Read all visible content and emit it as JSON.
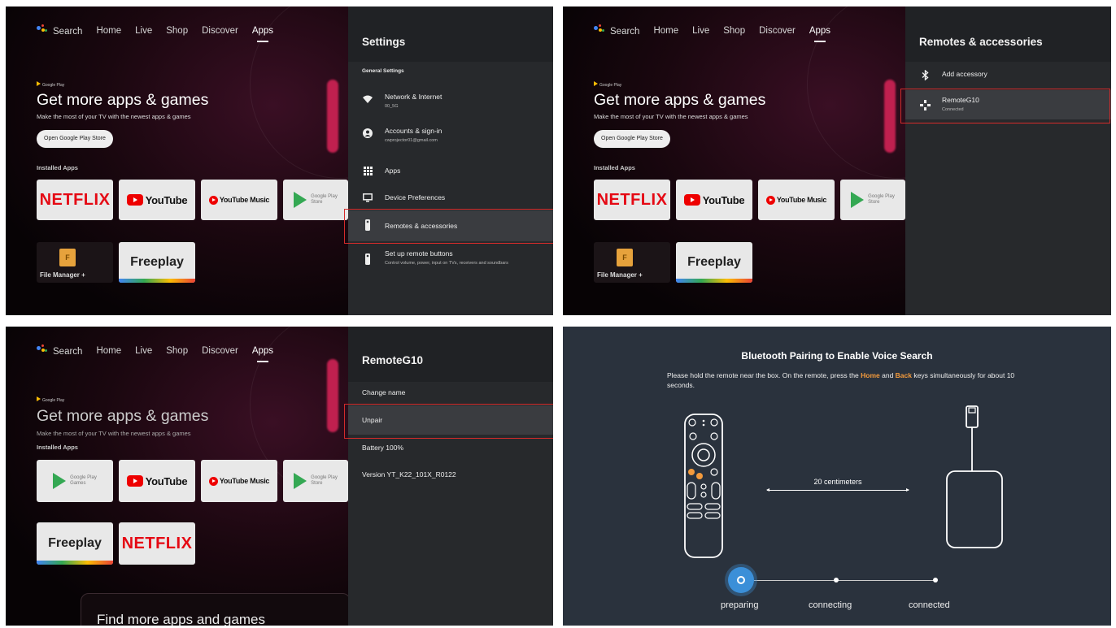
{
  "tv": {
    "nav": [
      "Search",
      "Home",
      "Live",
      "Shop",
      "Discover",
      "Apps"
    ],
    "google_play_label": "Google Play",
    "hero_title": "Get more apps & games",
    "hero_subtitle": "Make the most of your TV with the newest apps & games",
    "open_store_button": "Open Google Play Store",
    "installed_apps": "Installed Apps",
    "apps": {
      "netflix": "NETFLIX",
      "youtube": "YouTube",
      "youtube_music": "YouTube Music",
      "google_play_store": "Google Play Store",
      "google_play_store_l1": "Google Play",
      "google_play_store_l2": "Store",
      "google_play_games_l1": "Google Play",
      "google_play_games_l2": "Games",
      "freeplay": "Freeplay",
      "file_manager": "File Manager +",
      "file_manager_letter": "F"
    },
    "find_more": "Find more apps and games"
  },
  "settings": {
    "title": "Settings",
    "group": "General Settings",
    "items": [
      {
        "label": "Network & Internet",
        "sub": "00_5G",
        "icon": "wifi-icon"
      },
      {
        "label": "Accounts & sign-in",
        "sub": "cwprojector01@gmail.com",
        "icon": "account-icon"
      },
      {
        "label": "Apps",
        "sub": "",
        "icon": "apps-grid-icon"
      },
      {
        "label": "Device Preferences",
        "sub": "",
        "icon": "tv-icon"
      },
      {
        "label": "Remotes & accessories",
        "sub": "",
        "icon": "remote-icon"
      },
      {
        "label": "Set up remote buttons",
        "sub": "Control volume, power, input on TVs, receivers and soundbars",
        "icon": "remote-icon"
      }
    ]
  },
  "remotes": {
    "title": "Remotes & accessories",
    "items": [
      {
        "label": "Add accessory",
        "sub": "",
        "icon": "bluetooth-icon"
      },
      {
        "label": "RemoteG10",
        "sub": "Connected",
        "icon": "gamepad-icon"
      }
    ]
  },
  "remote_detail": {
    "title": "RemoteG10",
    "items": [
      "Change name",
      "Unpair",
      "Battery 100%",
      "Version YT_K22_101X_R0122"
    ]
  },
  "pairing": {
    "title": "Bluetooth Pairing to Enable Voice Search",
    "desc_part1": "Please hold the remote near the box. On the remote, press the ",
    "home_key": "Home",
    "desc_and": " and ",
    "back_key": "Back",
    "desc_part2": " keys simultaneously for about 10 seconds.",
    "distance": "20 centimeters",
    "steps": [
      "preparing",
      "connecting",
      "connected"
    ],
    "accent_color": "#f39a3c",
    "active_step_color": "#3b8fd8"
  },
  "highlight_color": "#d42b2b"
}
